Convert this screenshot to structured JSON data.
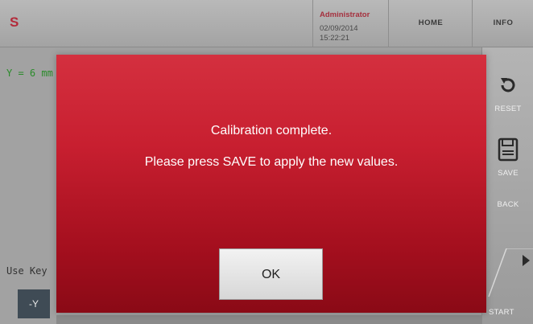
{
  "header": {
    "logo": "S",
    "user": {
      "name": "Administrator",
      "date": "02/09/2014",
      "time": "15:22:21"
    },
    "nav": {
      "home": "HOME",
      "info": "INFO"
    }
  },
  "main": {
    "y_readout": "Y = 6 mm",
    "use_keys": "Use Key",
    "minus_y_button": "-Y"
  },
  "sidebar": {
    "reset": "RESET",
    "save": "SAVE",
    "back": "BACK",
    "start": "START"
  },
  "dialog": {
    "line1": "Calibration complete.",
    "line2": "Please press SAVE to apply the new values.",
    "ok": "OK"
  },
  "colors": {
    "dialog_top": "#d4303f",
    "dialog_bottom": "#8a0a16",
    "brand": "#b32a3a",
    "readout_green": "#2b8b2b"
  },
  "icons": [
    "reset-icon",
    "save-icon",
    "play-icon"
  ]
}
